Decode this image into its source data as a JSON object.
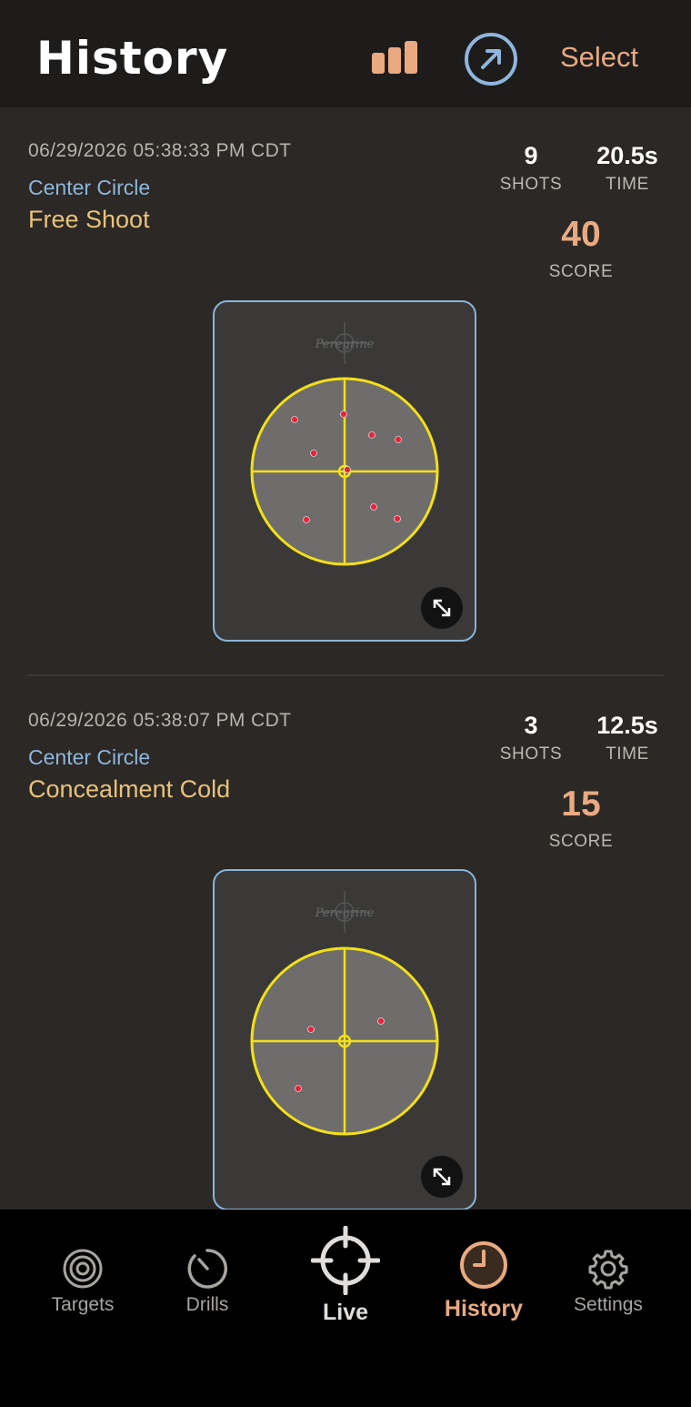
{
  "header": {
    "title": "History",
    "select_label": "Select",
    "stats_icon": "bar-chart-icon",
    "share_icon": "arrow-up-right-circle-icon",
    "accent": "#e9aa82",
    "blue": "#8fb6dc"
  },
  "sessions": [
    {
      "timestamp": "06/29/2026 05:38:33 PM CDT",
      "target": "Center Circle",
      "drill": "Free Shoot",
      "shots": "9",
      "shots_label": "SHOTS",
      "time": "20.5s",
      "time_label": "TIME",
      "score": "40",
      "score_label": "SCORE",
      "brand": "Peregrine"
    },
    {
      "timestamp": "06/29/2026 05:38:07 PM CDT",
      "target": "Center Circle",
      "drill": "Concealment Cold",
      "shots": "3",
      "shots_label": "SHOTS",
      "time": "12.5s",
      "time_label": "TIME",
      "score": "15",
      "score_label": "SCORE",
      "brand": "Peregrine"
    }
  ],
  "tabs": [
    {
      "label": "Targets",
      "icon": "target-icon"
    },
    {
      "label": "Drills",
      "icon": "stopwatch-icon"
    },
    {
      "label": "Live",
      "icon": "crosshair-icon"
    },
    {
      "label": "History",
      "icon": "clock-icon"
    },
    {
      "label": "Settings",
      "icon": "gear-icon"
    }
  ]
}
